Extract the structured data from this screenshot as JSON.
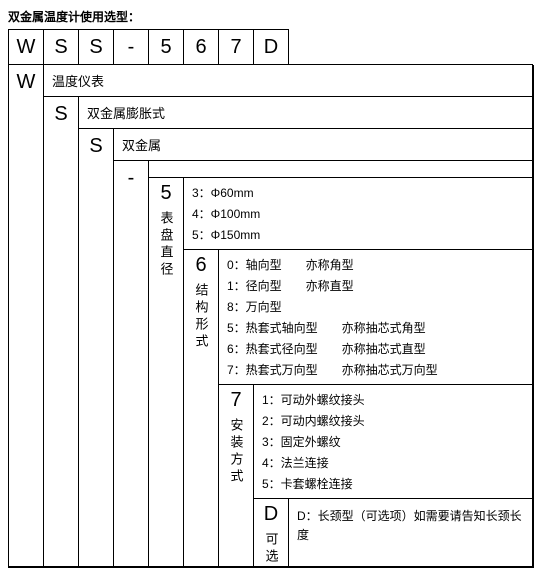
{
  "title": "双金属温度计使用选型：",
  "code": [
    "W",
    "S",
    "S",
    "-",
    "5",
    "6",
    "7",
    "D"
  ],
  "levels": [
    {
      "big": "W",
      "label": "温度仪表"
    },
    {
      "big": "S",
      "label": "双金属膨胀式"
    },
    {
      "big": "S",
      "label": "双金属"
    },
    {
      "big": "-",
      "label": ""
    }
  ],
  "spec5": {
    "num": "5",
    "cn": "表盘直径",
    "opts": [
      "3：Φ60mm",
      "4：Φ100mm",
      "5：Φ150mm"
    ]
  },
  "spec6": {
    "num": "6",
    "cn": "结构形式",
    "opts": [
      "0：轴向型　　亦称角型",
      "1：径向型　　亦称直型",
      "8：万向型",
      "5：热套式轴向型　　亦称抽芯式角型",
      "6：热套式径向型　　亦称抽芯式直型",
      "7：热套式万向型　　亦称抽芯式万向型"
    ]
  },
  "spec7": {
    "num": "7",
    "cn": "安装方式",
    "opts": [
      "1：可动外螺纹接头",
      "2：可动内螺纹接头",
      "3：固定外螺纹",
      "4：法兰连接",
      "5：卡套螺栓连接"
    ]
  },
  "specD": {
    "num": "D",
    "cn": "可选",
    "text": "D：长颈型（可选项）如需要请告知长颈长度"
  }
}
